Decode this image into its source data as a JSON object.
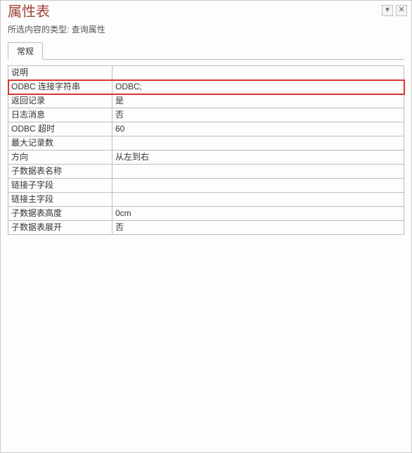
{
  "titlebar": {
    "title": "属性表",
    "dropdown_glyph": "▾",
    "close_glyph": "✕"
  },
  "subtitle": {
    "label": "所选内容的类型:",
    "value": "查询属性"
  },
  "tabs": {
    "active": "常规"
  },
  "rows": [
    {
      "label": "说明",
      "value": ""
    },
    {
      "label": "ODBC 连接字符串",
      "value": "ODBC;",
      "highlight": true
    },
    {
      "label": "返回记录",
      "value": "是"
    },
    {
      "label": "日志消息",
      "value": "否"
    },
    {
      "label": "ODBC 超时",
      "value": "60"
    },
    {
      "label": "最大记录数",
      "value": ""
    },
    {
      "label": "方向",
      "value": "从左到右"
    },
    {
      "label": "子数据表名称",
      "value": ""
    },
    {
      "label": "链接子字段",
      "value": ""
    },
    {
      "label": "链接主字段",
      "value": ""
    },
    {
      "label": "子数据表高度",
      "value": "0cm"
    },
    {
      "label": "子数据表展开",
      "value": "否"
    }
  ]
}
